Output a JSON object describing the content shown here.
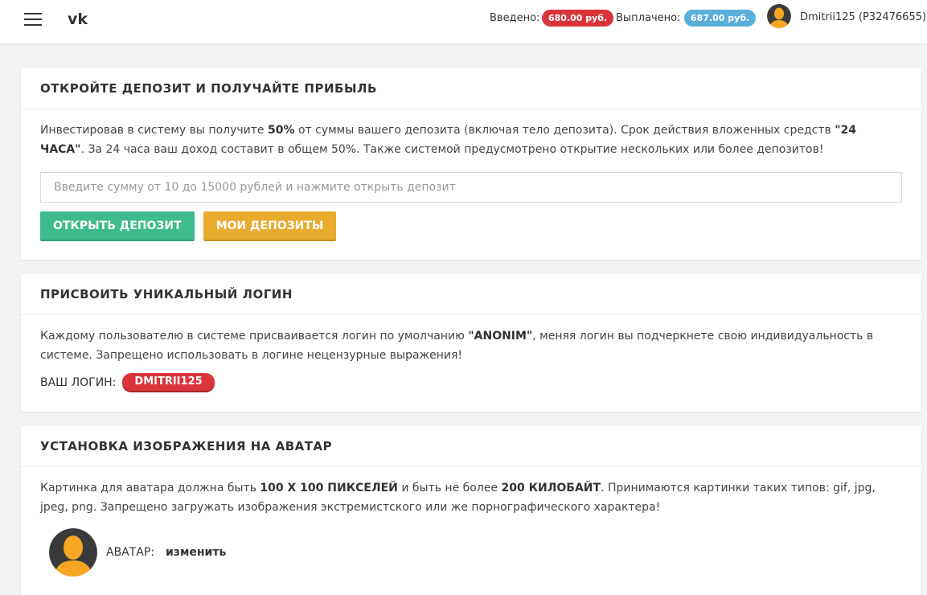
{
  "header": {
    "menu_icon": "hamburger-menu-icon",
    "logo_icon": "vk-logo-icon",
    "deposited_label": "Введено:",
    "deposited_value": "680.00 руб.",
    "deposited_color": "#d9343a",
    "withdrawn_label": "Выплачено:",
    "withdrawn_value": "687.00 руб.",
    "withdrawn_color": "#5aaed9",
    "user_avatar_icon": "user-avatar-icon",
    "user_name": "Dmitrii125 (P32476655)"
  },
  "deposit_card": {
    "title": "ОТКРОЙТЕ ДЕПОЗИТ И ПОЛУЧАЙТЕ ПРИБЫЛЬ",
    "text_1": "Инвестировав в систему вы получите ",
    "text_bold_1": "50%",
    "text_2": " от суммы вашего депозита (включая тело депозита). Срок действия вложенных средств ",
    "text_bold_2": "\"24 ЧАСА\"",
    "text_3": ". За 24 часа ваш доход составит в общем 50%. Также системой предусмотрено открытие нескольких или более депозитов!",
    "input_placeholder": "Введите сумму от 10 до 15000 рублей и нажмите открыть депозит",
    "input_value": "",
    "open_button": "ОТКРЫТЬ ДЕПОЗИТ",
    "my_deposits_button": "МОИ ДЕПОЗИТЫ",
    "open_button_color": "#3dbb8c",
    "my_deposits_button_color": "#e9ab2d"
  },
  "login_card": {
    "title": "ПРИСВОИТЬ УНИКАЛЬНЫЙ ЛОГИН",
    "text_1": "Каждому пользователю в системе присваивается логин по умолчанию ",
    "text_bold": "\"ANONIM\"",
    "text_2": ", меняя логин вы подчеркнете свою индивидуальность в системе. Запрещено использовать в логине нецензурные выражения!",
    "login_label": "ВАШ ЛОГИН:",
    "login_value": "DMITRII125"
  },
  "avatar_card": {
    "title": "УСТАНОВКА ИЗОБРАЖЕНИЯ НА АВАТАР",
    "text_1": "Картинка для аватара должна быть ",
    "text_bold_1": "100 X 100 ПИКСЕЛЕЙ",
    "text_2": " и быть не более ",
    "text_bold_2": "200 КИЛОБАЙТ",
    "text_3": ". Принимаются картинки таких типов: gif, jpg, jpeg, png. Запрещено загружать изображения экстремистского или же порнографического характера!",
    "avatar_icon": "avatar-silhouette-icon",
    "avatar_label": "АВАТАР:",
    "change_link": "изменить"
  }
}
